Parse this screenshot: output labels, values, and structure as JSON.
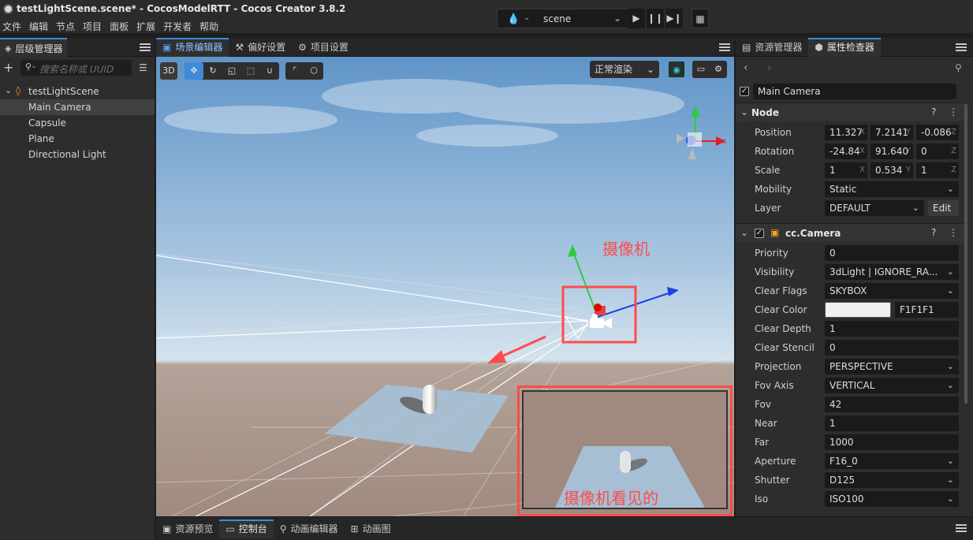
{
  "window": {
    "title": "testLightScene.scene* - CocosModelRTT - Cocos Creator 3.8.2"
  },
  "menu": [
    "文件",
    "编辑",
    "节点",
    "项目",
    "面板",
    "扩展",
    "开发者",
    "帮助"
  ],
  "toolbar": {
    "scene_name": "scene"
  },
  "hierarchy": {
    "title": "层级管理器",
    "search_placeholder": "搜索名称或 UUID",
    "root": "testLightScene",
    "items": [
      "Main Camera",
      "Capsule",
      "Plane",
      "Directional Light"
    ],
    "selected_index": 0
  },
  "scene_panel": {
    "tabs": [
      "场景编辑器",
      "偏好设置",
      "项目设置"
    ],
    "mode_3d": "3D",
    "render_mode": "正常渲染",
    "annotation_camera": "摄像机",
    "annotation_preview": "摄像机看见的",
    "colors": {
      "sky_top": "#5f94c8",
      "ground": "#a08a7f",
      "highlight": "#ff4b4b",
      "plane": "#a6bfd4"
    }
  },
  "inspector": {
    "tabs": [
      "资源管理器",
      "属性检查器"
    ],
    "node_name": "Main Camera",
    "node_section": "Node",
    "position": {
      "x": "11.327",
      "y": "7.2141",
      "z": "-0.086"
    },
    "rotation": {
      "x": "-24.84",
      "y": "91.640",
      "z": "0"
    },
    "scale": {
      "x": "1",
      "y": "0.534",
      "z": "1"
    },
    "labels": {
      "position": "Position",
      "rotation": "Rotation",
      "scale": "Scale",
      "mobility": "Mobility",
      "layer": "Layer",
      "edit": "Edit",
      "axis_x": "X",
      "axis_y": "Y",
      "axis_z": "Z"
    },
    "mobility": "Static",
    "layer": "DEFAULT",
    "camera_section": "cc.Camera",
    "camera_props": [
      {
        "label": "Priority",
        "value": "0",
        "kind": "input"
      },
      {
        "label": "Visibility",
        "value": "3dLight | IGNORE_RA...",
        "kind": "select"
      },
      {
        "label": "Clear Flags",
        "value": "SKYBOX",
        "kind": "select"
      },
      {
        "label": "Clear Color",
        "value": "F1F1F1",
        "kind": "color"
      },
      {
        "label": "Clear Depth",
        "value": "1",
        "kind": "input"
      },
      {
        "label": "Clear Stencil",
        "value": "0",
        "kind": "input"
      },
      {
        "label": "Projection",
        "value": "PERSPECTIVE",
        "kind": "select"
      },
      {
        "label": "Fov Axis",
        "value": "VERTICAL",
        "kind": "select"
      },
      {
        "label": "Fov",
        "value": "42",
        "kind": "input"
      },
      {
        "label": "Near",
        "value": "1",
        "kind": "input"
      },
      {
        "label": "Far",
        "value": "1000",
        "kind": "input"
      },
      {
        "label": "Aperture",
        "value": "F16_0",
        "kind": "select"
      },
      {
        "label": "Shutter",
        "value": "D125",
        "kind": "select"
      },
      {
        "label": "Iso",
        "value": "ISO100",
        "kind": "select"
      }
    ]
  },
  "bottom_tabs": [
    "资源预览",
    "控制台",
    "动画编辑器",
    "动画图"
  ],
  "bottom_active": 1
}
